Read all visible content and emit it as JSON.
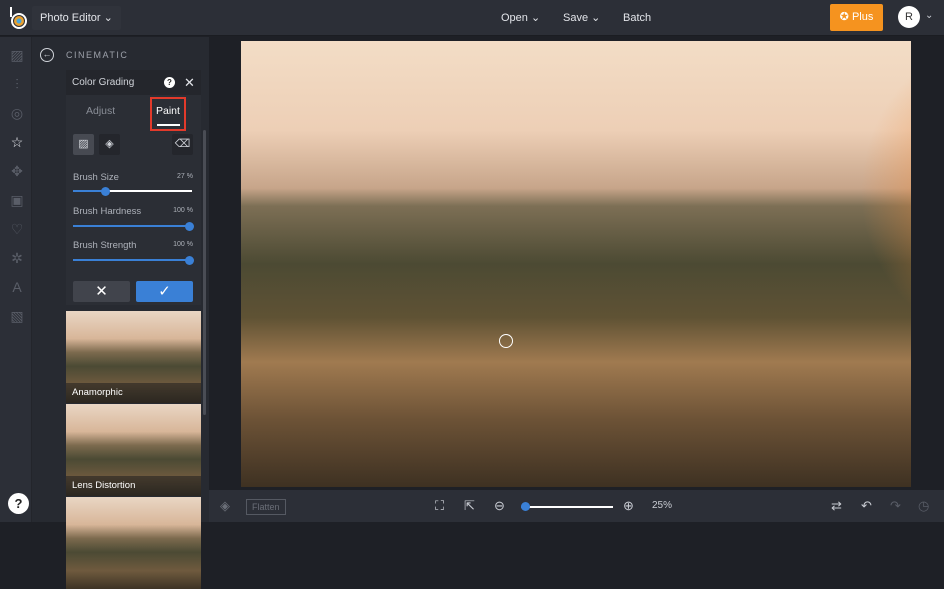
{
  "header": {
    "app_title": "Photo Editor",
    "open": "Open",
    "save": "Save",
    "batch": "Batch",
    "plus": "Plus",
    "avatar_initial": "R"
  },
  "panel": {
    "category": "CINEMATIC",
    "tool_title": "Color Grading",
    "tabs": [
      "Adjust",
      "Paint"
    ],
    "active_tab": "Paint",
    "sliders": [
      {
        "label": "Brush Size",
        "value": "27 %",
        "fraction": 0.27
      },
      {
        "label": "Brush Hardness",
        "value": "100 %",
        "fraction": 1
      },
      {
        "label": "Brush Strength",
        "value": "100 %",
        "fraction": 1
      }
    ],
    "presets": [
      "Anamorphic",
      "Lens Distortion"
    ]
  },
  "bottom": {
    "flatten": "Flatten",
    "zoom": "25%",
    "zoom_fraction": 0.05
  },
  "help": "?"
}
